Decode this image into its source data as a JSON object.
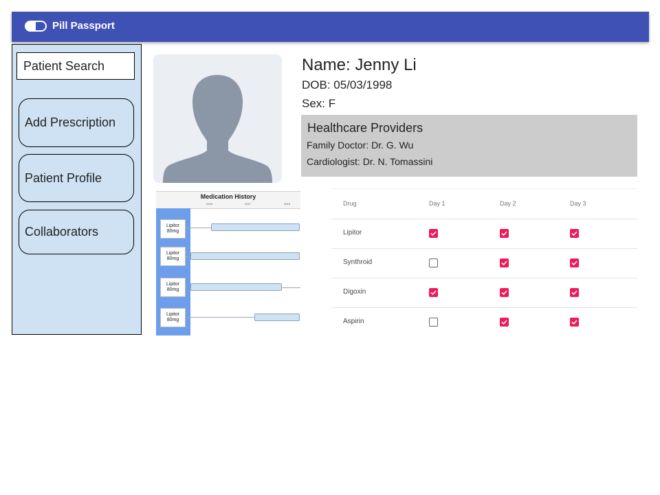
{
  "app": {
    "title": "Pill Passport"
  },
  "sidebar": {
    "search_label": "Patient Search",
    "buttons": [
      "Add Prescription",
      "Patient Profile",
      "Collaborators"
    ]
  },
  "patient": {
    "name": "Name: Jenny Li",
    "dob": "DOB: 05/03/1998",
    "sex": "Sex: F"
  },
  "providers": {
    "title": "Healthcare Providers",
    "lines": [
      "Family Doctor: Dr. G. Wu",
      "Cardiologist: Dr. N. Tomassini"
    ]
  },
  "medication_history": {
    "title": "Medication History",
    "years": [
      "2016",
      "2017",
      "2018"
    ],
    "items": [
      "Lipitor\n80mg",
      "Lipitor\n80mg",
      "Lipitor\n80mg",
      "Lipitor\n80mg"
    ]
  },
  "tracker": {
    "headers": [
      "Drug",
      "Day 1",
      "Day 2",
      "Day 3"
    ],
    "rows": [
      {
        "drug": "Lipitor",
        "days": [
          true,
          true,
          true
        ]
      },
      {
        "drug": "Synthroid",
        "days": [
          false,
          true,
          true
        ]
      },
      {
        "drug": "Digoxin",
        "days": [
          true,
          true,
          true
        ]
      },
      {
        "drug": "Aspirin",
        "days": [
          false,
          true,
          true
        ]
      }
    ]
  },
  "colors": {
    "topbar": "#4051b5",
    "sidebar": "#cfe2f3",
    "providers_bg": "#cccccc",
    "checkbox_on": "#f0195a",
    "timeline_column": "#6d9eeb"
  }
}
